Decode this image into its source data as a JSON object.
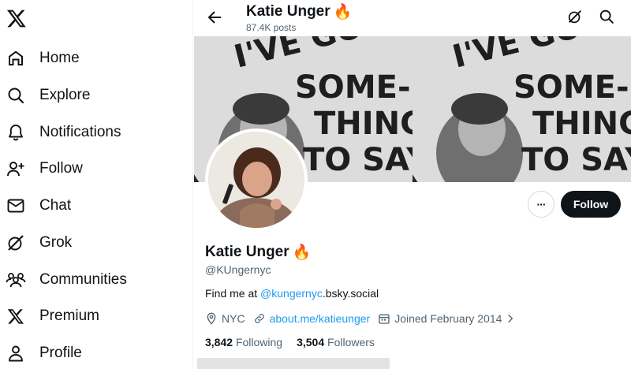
{
  "nav": {
    "logo": "x-logo-icon",
    "items": [
      {
        "label": "Home",
        "icon": "home-icon"
      },
      {
        "label": "Explore",
        "icon": "search-icon"
      },
      {
        "label": "Notifications",
        "icon": "bell-icon"
      },
      {
        "label": "Follow",
        "icon": "add-user-icon"
      },
      {
        "label": "Chat",
        "icon": "envelope-icon"
      },
      {
        "label": "Grok",
        "icon": "grok-icon"
      },
      {
        "label": "Communities",
        "icon": "communities-icon"
      },
      {
        "label": "Premium",
        "icon": "x-logo-icon"
      },
      {
        "label": "Profile",
        "icon": "person-icon"
      }
    ]
  },
  "header": {
    "name": "Katie Unger",
    "emoji": "🔥",
    "posts": "87.4K posts"
  },
  "banner": {
    "text_lines": [
      "I'VE GOT",
      "SOME-",
      "THING",
      "TO SAY"
    ]
  },
  "actions": {
    "more": "···",
    "follow": "Follow"
  },
  "profile": {
    "name": "Katie Unger",
    "emoji": "🔥",
    "handle": "@KUngernyc",
    "bio_prefix": "Find me at ",
    "bio_link": "@kungernyc",
    "bio_suffix": ".bsky.social",
    "location": "NYC",
    "website": "about.me/katieunger",
    "joined": "Joined February 2014",
    "following_count": "3,842",
    "following_label": "Following",
    "followers_count": "3,504",
    "followers_label": "Followers"
  },
  "colors": {
    "accent": "#1d9bf0",
    "text": "#0f1419",
    "secondary": "#536471"
  }
}
